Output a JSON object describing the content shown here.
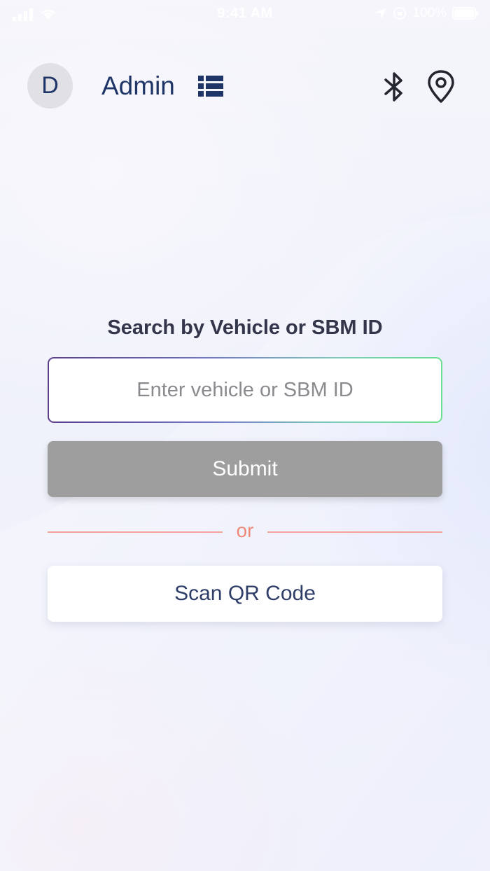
{
  "status_bar": {
    "time": "9:41 AM",
    "battery": "100%",
    "icons": [
      "signal-icon",
      "wifi-icon",
      "location-arrow-icon",
      "orientation-lock-icon",
      "battery-icon"
    ]
  },
  "header": {
    "avatar_initial": "D",
    "username": "Admin",
    "icons": [
      "list-icon",
      "bluetooth-icon",
      "location-pin-icon"
    ],
    "text_color": "#1f3567"
  },
  "search": {
    "title": "Search by Vehicle or SBM ID",
    "placeholder": "Enter vehicle or SBM ID",
    "value": "",
    "submit_label": "Submit",
    "divider_text": "or",
    "scan_label": "Scan QR Code"
  },
  "colors": {
    "submit_bg": "#9e9e9e",
    "divider": "#ef8a7a",
    "scan_text": "#2f3d69",
    "input_border_start": "#5a3f8c",
    "input_border_end": "#6be08e"
  }
}
